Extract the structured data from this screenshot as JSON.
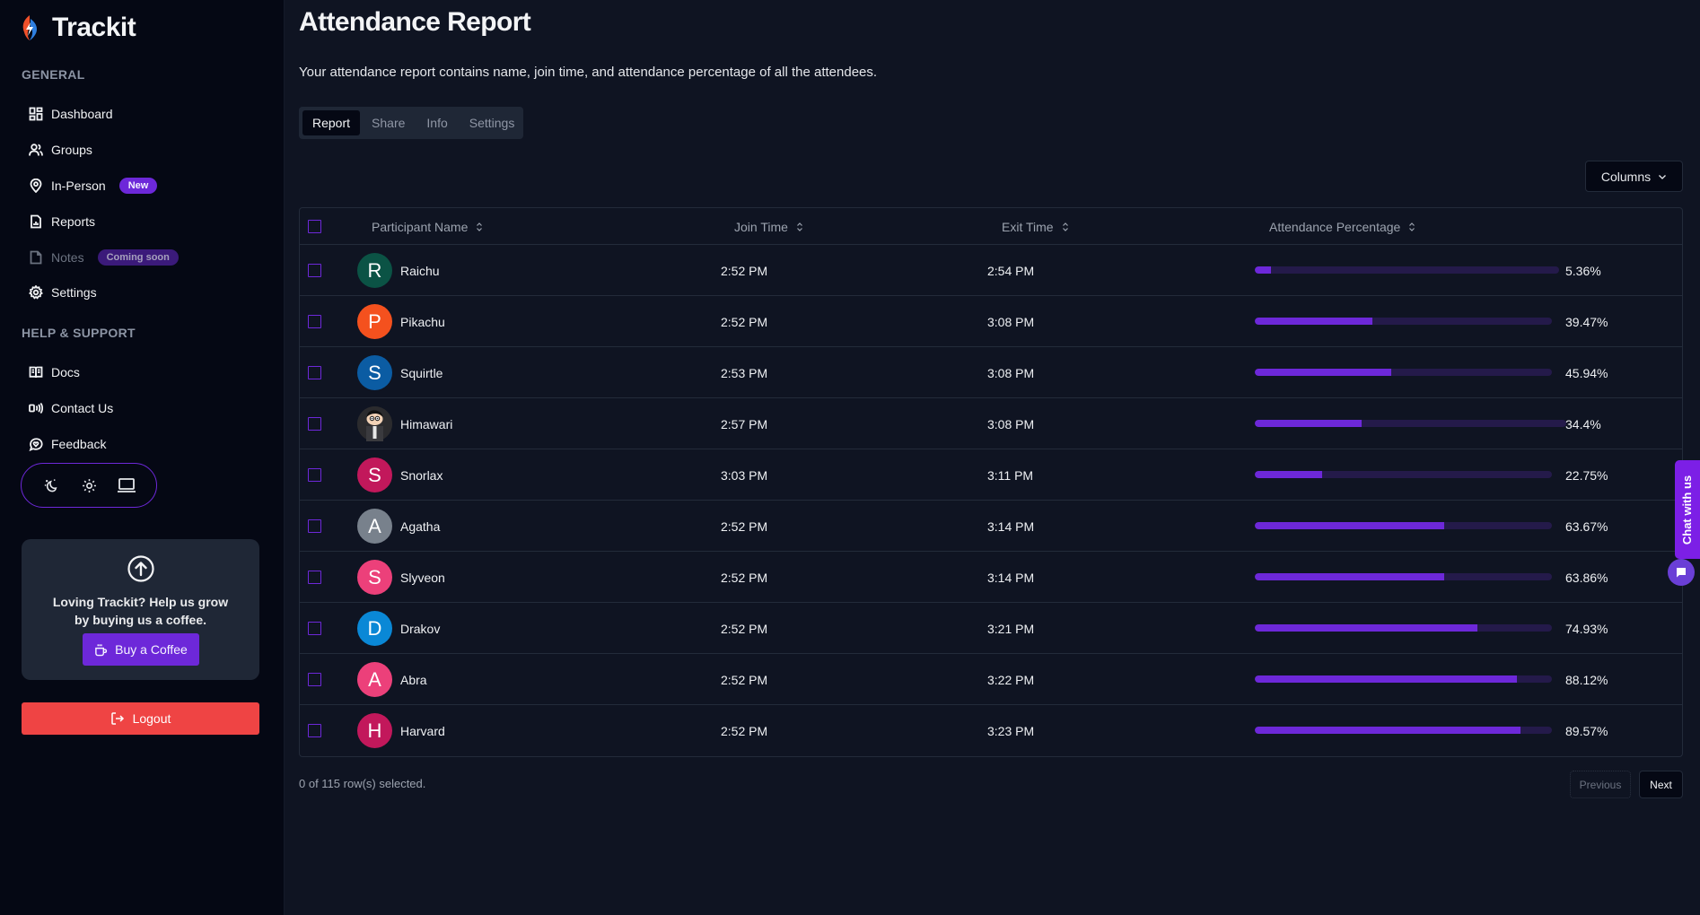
{
  "app": {
    "name": "Trackit"
  },
  "sidebar": {
    "general_label": "GENERAL",
    "general_items": [
      {
        "label": "Dashboard",
        "icon": "dashboard-icon"
      },
      {
        "label": "Groups",
        "icon": "users-icon"
      },
      {
        "label": "In-Person",
        "icon": "map-pin-icon",
        "badge": "New"
      },
      {
        "label": "Reports",
        "icon": "report-file-icon"
      },
      {
        "label": "Notes",
        "icon": "note-icon",
        "badge": "Coming soon",
        "disabled": true
      },
      {
        "label": "Settings",
        "icon": "gear-icon"
      }
    ],
    "help_label": "HELP & SUPPORT",
    "help_items": [
      {
        "label": "Docs",
        "icon": "book-icon"
      },
      {
        "label": "Contact Us",
        "icon": "broadcast-icon"
      },
      {
        "label": "Feedback",
        "icon": "feedback-heart-icon"
      }
    ],
    "theme_options": [
      "dark",
      "light",
      "system"
    ],
    "theme_selected": "system",
    "promo": {
      "text": "Loving Trackit? Help us grow by buying us a coffee.",
      "button_label": "Buy a Coffee"
    },
    "logout_label": "Logout"
  },
  "main": {
    "title": "Attendance Report",
    "subtitle": "Your attendance report contains name, join time, and attendance percentage of all the attendees.",
    "tabs": [
      {
        "label": "Report",
        "active": true
      },
      {
        "label": "Share",
        "active": false
      },
      {
        "label": "Info",
        "active": false
      },
      {
        "label": "Settings",
        "active": false
      }
    ],
    "columns_button_label": "Columns",
    "table": {
      "headers": [
        "Participant Name",
        "Join Time",
        "Exit Time",
        "Attendance Percentage"
      ],
      "rows": [
        {
          "initial": "R",
          "name": "Raichu",
          "join": "2:52 PM",
          "exit": "2:54 PM",
          "percent_label": "5.36%",
          "percent": 5.36,
          "avatar_color": "#0b5345"
        },
        {
          "initial": "P",
          "name": "Pikachu",
          "join": "2:52 PM",
          "exit": "3:08 PM",
          "percent_label": "39.47%",
          "percent": 39.47,
          "avatar_color": "#f4511e"
        },
        {
          "initial": "S",
          "name": "Squirtle",
          "join": "2:53 PM",
          "exit": "3:08 PM",
          "percent_label": "45.94%",
          "percent": 45.94,
          "avatar_color": "#0b5ca3"
        },
        {
          "initial": "",
          "name": "Himawari",
          "join": "2:57 PM",
          "exit": "3:08 PM",
          "percent_label": "34.4%",
          "percent": 34.4,
          "avatar_color": "#2b2b2e",
          "avatar_image": true
        },
        {
          "initial": "S",
          "name": "Snorlax",
          "join": "3:03 PM",
          "exit": "3:11 PM",
          "percent_label": "22.75%",
          "percent": 22.75,
          "avatar_color": "#c2185b"
        },
        {
          "initial": "A",
          "name": "Agatha",
          "join": "2:52 PM",
          "exit": "3:14 PM",
          "percent_label": "63.67%",
          "percent": 63.67,
          "avatar_color": "#78818c"
        },
        {
          "initial": "S",
          "name": "Slyveon",
          "join": "2:52 PM",
          "exit": "3:14 PM",
          "percent_label": "63.86%",
          "percent": 63.86,
          "avatar_color": "#ec407a"
        },
        {
          "initial": "D",
          "name": "Drakov",
          "join": "2:52 PM",
          "exit": "3:21 PM",
          "percent_label": "74.93%",
          "percent": 74.93,
          "avatar_color": "#0a88d6"
        },
        {
          "initial": "A",
          "name": "Abra",
          "join": "2:52 PM",
          "exit": "3:22 PM",
          "percent_label": "88.12%",
          "percent": 88.12,
          "avatar_color": "#ec407a"
        },
        {
          "initial": "H",
          "name": "Harvard",
          "join": "2:52 PM",
          "exit": "3:23 PM",
          "percent_label": "89.57%",
          "percent": 89.57,
          "avatar_color": "#c2185b"
        }
      ]
    },
    "selection_status": "0 of 115 row(s) selected.",
    "pagination": {
      "previous_label": "Previous",
      "next_label": "Next"
    }
  },
  "chat_widget": {
    "label": "Chat with us"
  },
  "colors": {
    "accent": "#6d28d9",
    "danger": "#ef4444",
    "background": "#0f1422",
    "sidebar": "#050814",
    "bar_track": "#241a4a"
  }
}
